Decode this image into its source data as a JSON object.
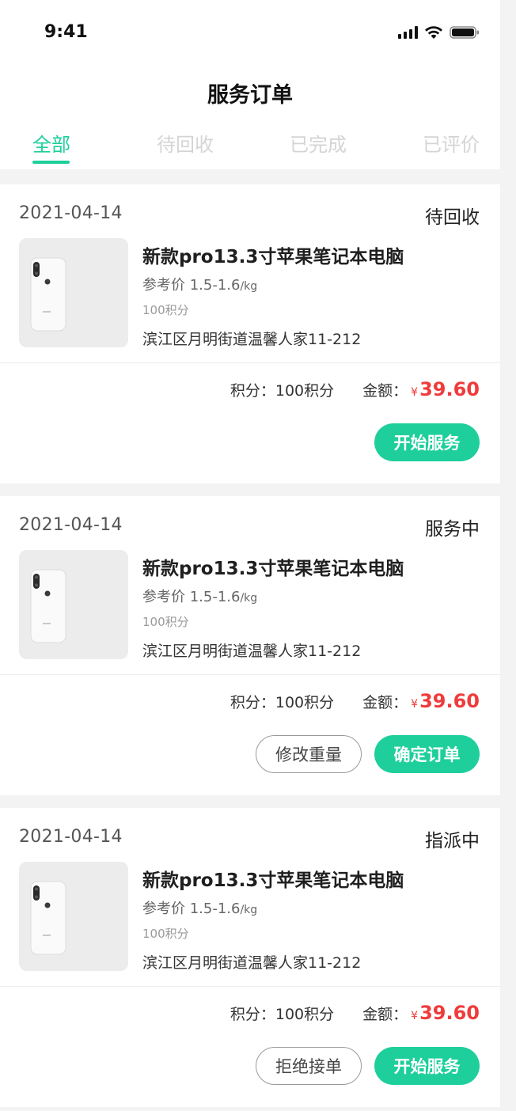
{
  "status_bar": {
    "time": "9:41"
  },
  "header": {
    "title": "服务订单"
  },
  "tabs": [
    {
      "label": "全部",
      "active": true
    },
    {
      "label": "待回收",
      "active": false
    },
    {
      "label": "已完成",
      "active": false
    },
    {
      "label": "已评价",
      "active": false
    }
  ],
  "orders": [
    {
      "date": "2021-04-14",
      "status": "待回收",
      "product_name": "新款pro13.3寸苹果笔记本电脑",
      "price_label": "参考价 1.5-1.6",
      "price_unit": "/kg",
      "points": "100积分",
      "address": "滨江区月明街道温馨人家11-212",
      "points_summary": "积分：100积分",
      "amount_label": "金额：",
      "currency": "¥",
      "amount": "39.60",
      "primary_button": "开始服务",
      "secondary_button": ""
    },
    {
      "date": "2021-04-14",
      "status": "服务中",
      "product_name": "新款pro13.3寸苹果笔记本电脑",
      "price_label": "参考价 1.5-1.6",
      "price_unit": "/kg",
      "points": "100积分",
      "address": "滨江区月明街道温馨人家11-212",
      "points_summary": "积分：100积分",
      "amount_label": "金额：",
      "currency": "¥",
      "amount": "39.60",
      "primary_button": "确定订单",
      "secondary_button": "修改重量"
    },
    {
      "date": "2021-04-14",
      "status": "指派中",
      "product_name": "新款pro13.3寸苹果笔记本电脑",
      "price_label": "参考价 1.5-1.6",
      "price_unit": "/kg",
      "points": "100积分",
      "address": "滨江区月明街道温馨人家11-212",
      "points_summary": "积分：100积分",
      "amount_label": "金额：",
      "currency": "¥",
      "amount": "39.60",
      "primary_button": "开始服务",
      "secondary_button": "拒绝接单"
    }
  ],
  "colors": {
    "accent": "#1ecf9b",
    "price": "#f03b3b",
    "background": "#f3f3f3"
  },
  "icons": [
    "signal-icon",
    "wifi-icon",
    "battery-icon",
    "phone-product-image"
  ]
}
